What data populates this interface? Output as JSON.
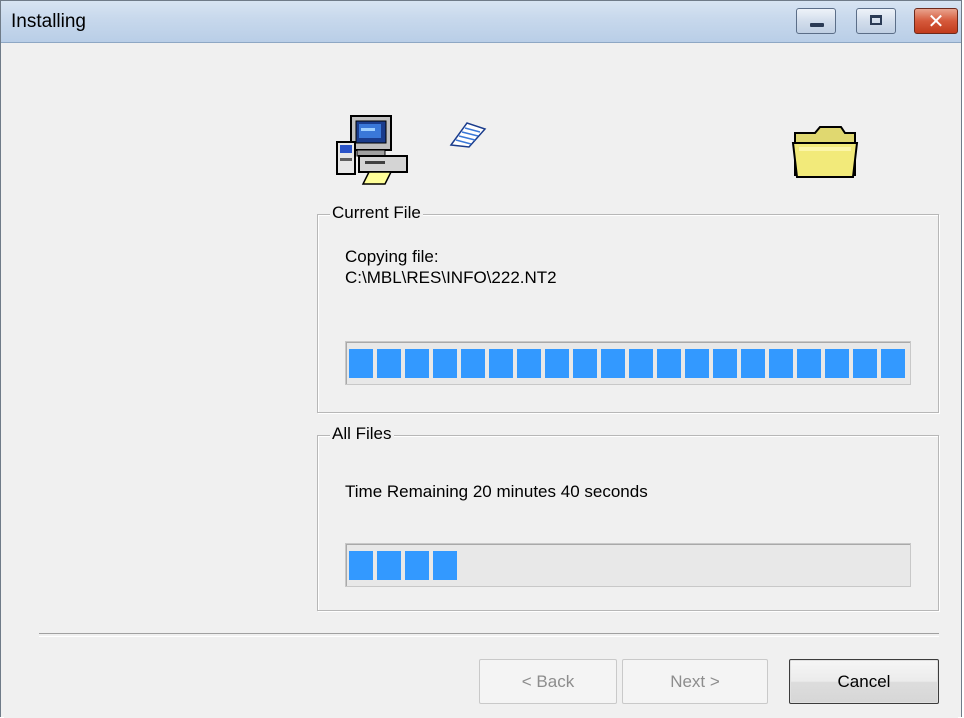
{
  "window": {
    "title": "Installing"
  },
  "icons": {
    "computer": "setup-computer-icon",
    "paper": "flying-paper-icon",
    "folder": "destination-folder-icon",
    "minimize": "minimize-icon",
    "maximize": "maximize-icon",
    "close": "close-icon",
    "close_glyph": "✕"
  },
  "current_file": {
    "legend": "Current File",
    "label": "Copying file:",
    "path": "C:\\MBL\\RES\\INFO\\222.NT2",
    "progress_percent": 100
  },
  "all_files": {
    "legend": "All Files",
    "status": "Time Remaining 20 minutes 40 seconds",
    "progress_percent": 20
  },
  "buttons": {
    "back": "< Back",
    "next": "Next >",
    "cancel": "Cancel"
  },
  "colors": {
    "progress": "#3399ff",
    "title_bar": "#c7d8ec",
    "close_button": "#d5593b"
  }
}
